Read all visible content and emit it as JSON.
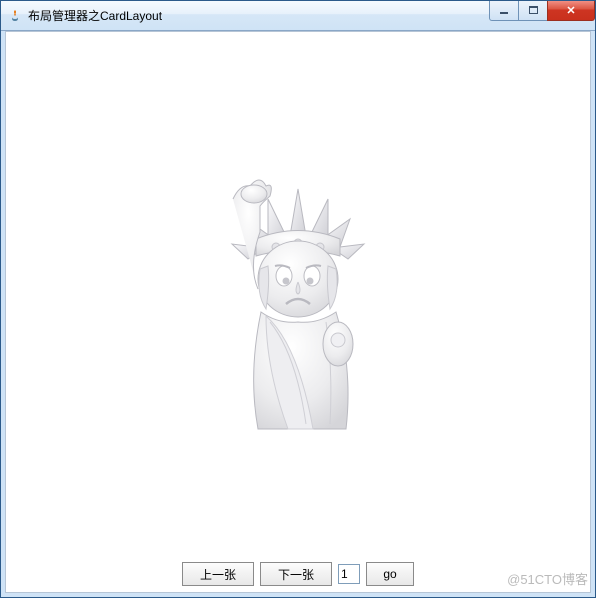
{
  "window": {
    "title": "布局管理器之CardLayout"
  },
  "controls": {
    "prev_label": "上一张",
    "next_label": "下一张",
    "input_value": "1",
    "go_label": "go"
  },
  "watermark": "@51CTO博客"
}
